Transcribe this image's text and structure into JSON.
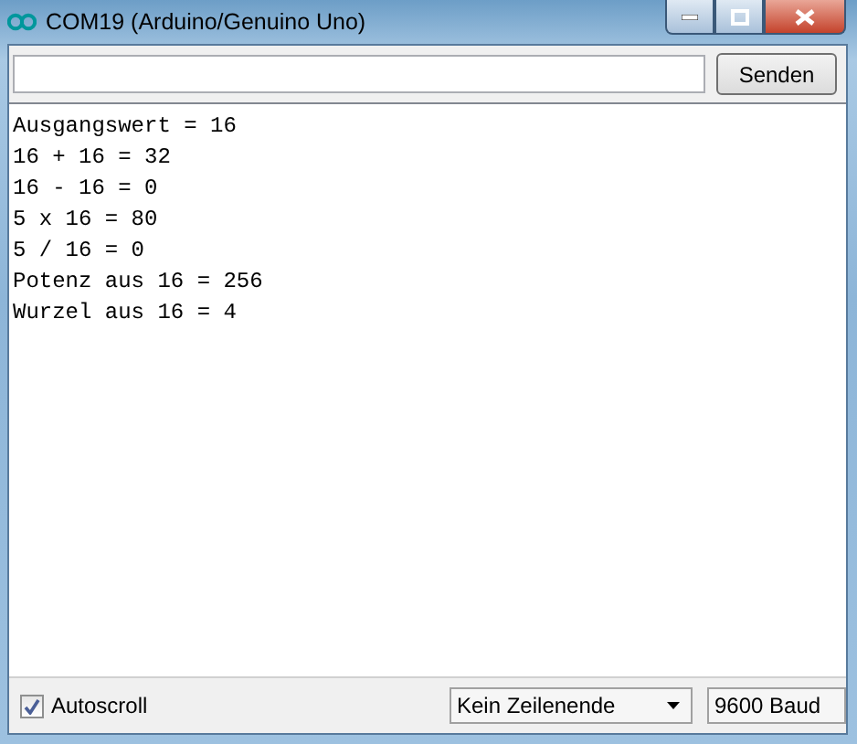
{
  "window": {
    "title": "COM19 (Arduino/Genuino Uno)"
  },
  "send_button": {
    "label": "Senden"
  },
  "output_lines": [
    "Ausgangswert = 16",
    "16 + 16 = 32",
    "16 - 16 = 0",
    "5 x 16 = 80",
    "5 / 16 = 0",
    "Potenz aus 16 = 256",
    "Wurzel aus 16 = 4"
  ],
  "autoscroll": {
    "label": "Autoscroll",
    "checked": true
  },
  "line_ending": {
    "value": "Kein Zeilenende"
  },
  "baud_rate": {
    "value": "9600 Baud"
  }
}
